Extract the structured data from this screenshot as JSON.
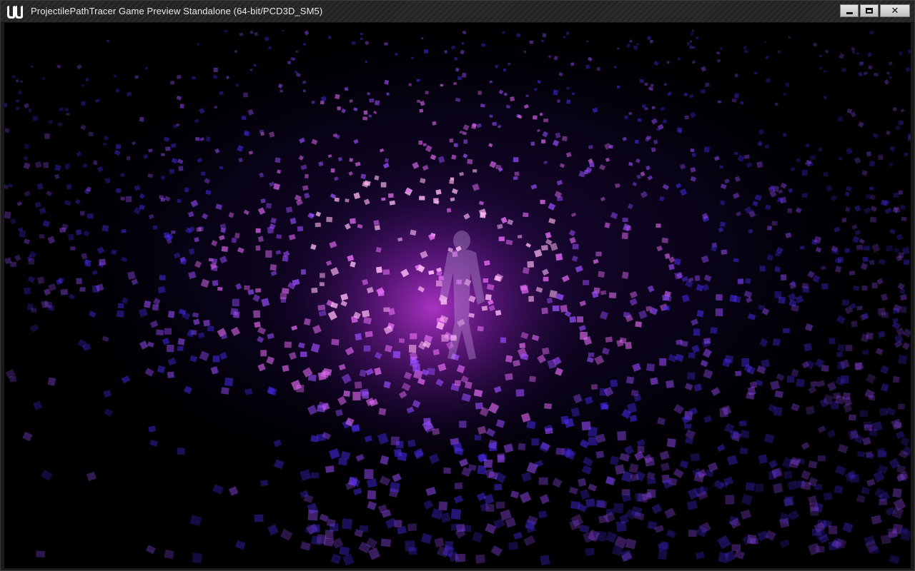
{
  "window": {
    "title": "ProjectilePathTracer Game Preview Standalone (64-bit/PCD3D_SM5)",
    "logo_icon": "unreal-engine-logo-icon",
    "controls": {
      "minimize_icon": "minimize-icon",
      "maximize_icon": "maximize-icon",
      "close_icon": "close-icon",
      "close_glyph": "✕"
    }
  },
  "scene": {
    "description_icon": "particle-field",
    "colors": {
      "background": "#000000",
      "glow_center": "#b12fc9",
      "particle_hot": "#ffb7f5",
      "particle_pink": "#e069f2",
      "particle_violet": "#9b4dff",
      "particle_blue": "#4a2bf0",
      "character": "#c7a3e0"
    }
  }
}
